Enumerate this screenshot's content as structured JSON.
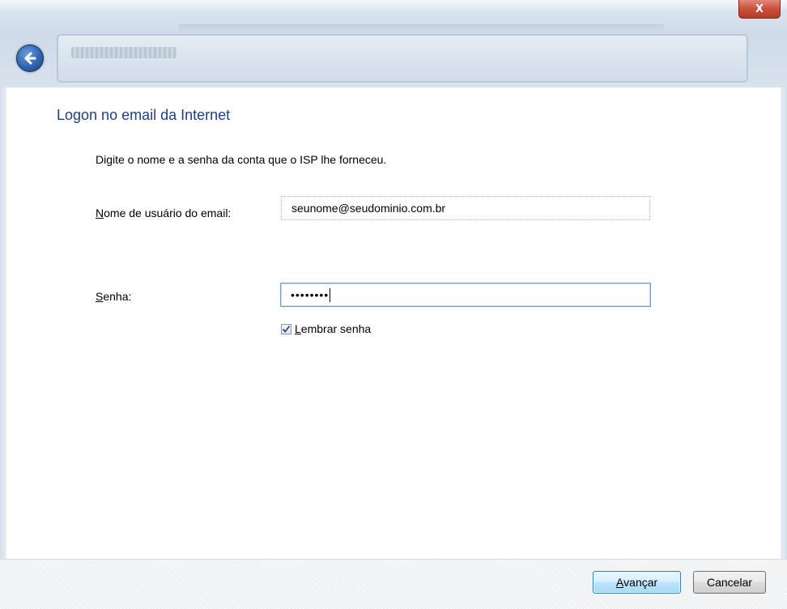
{
  "window": {
    "close_glyph": "X"
  },
  "header": {
    "back_icon": "back-arrow-icon"
  },
  "main": {
    "heading": "Logon no email da Internet",
    "instructions": "Digite o nome e a senha da conta que o ISP lhe forneceu.",
    "username_label_mnemonic": "N",
    "username_label_rest": "ome de usuário do email:",
    "username_value": "seunome@seudominio.com.br",
    "password_label_mnemonic": "S",
    "password_label_rest": "enha:",
    "password_masked": "••••••••",
    "remember_checked": true,
    "remember_label_mnemonic": "L",
    "remember_label_rest": "embrar senha"
  },
  "footer": {
    "next_label_mnemonic": "A",
    "next_label_rest": "vançar",
    "cancel_label": "Cancelar"
  },
  "colors": {
    "heading": "#1e3f8a",
    "accent_button_border": "#3c7fb1",
    "close_button": "#c9503b"
  }
}
